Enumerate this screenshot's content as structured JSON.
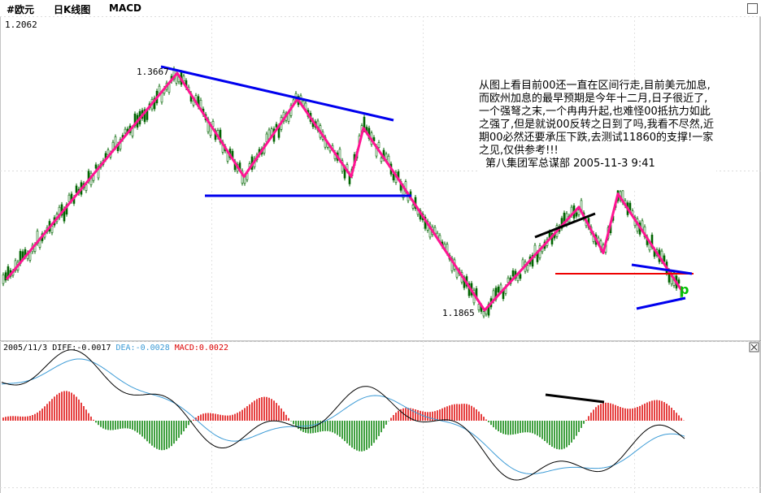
{
  "titlebar": {
    "symbol": "#欧元",
    "period": "日K线图",
    "indicator": "MACD"
  },
  "price_panel": {
    "top_price_label": "1.2062",
    "high_label": "1.3667",
    "low_label": "1.1865",
    "marker": "p"
  },
  "annotation": {
    "text": "从图上看目前00还一直在区间行走,目前美元加息,而欧州加息的最早预期是今年十二月,日子很近了,一个强弩之末,一个冉冉升起,也难怪00抵抗力如此之强了,但是就说00反转之日到了吗,我看不尽然,近期00必然还要承压下跌,去测试11860的支撑!一家之见,仅供参考!!!",
    "signature": "第八集团军总谋部 2005-11-3 9:41"
  },
  "macd_header": {
    "date": "2005/11/3",
    "diff": "DIFF:-0.0017",
    "dea": "DEA:-0.0028",
    "macd": "MACD:0.0022"
  },
  "colors": {
    "trend_pink": "#ff1493",
    "trendline_blue": "#0000ee",
    "trendline_black": "#000000",
    "resistance_red": "#ee0000",
    "candle_green": "#006400",
    "hist_up": "#dd0000",
    "hist_down": "#008000",
    "dea_line": "#3c9bd6",
    "diff_line": "#000000",
    "marker_green": "#00c000"
  },
  "chart_data": {
    "type": "line",
    "title": "#欧元 日K线图",
    "price_path": [
      {
        "label": "",
        "value": 1.21
      },
      {
        "label": "1.3667",
        "value": 1.3667
      },
      {
        "label": "",
        "value": 1.288
      },
      {
        "label": "",
        "value": 1.347
      },
      {
        "label": "",
        "value": 1.288
      },
      {
        "label": "",
        "value": 1.325
      },
      {
        "label": "",
        "value": 1.288
      },
      {
        "label": "1.1865",
        "value": 1.1865
      },
      {
        "label": "",
        "value": 1.265
      },
      {
        "label": "",
        "value": 1.23
      },
      {
        "label": "",
        "value": 1.275
      },
      {
        "label": "",
        "value": 1.2
      }
    ],
    "macd": {
      "diff": -0.0017,
      "dea": -0.0028,
      "macd": 0.0022
    }
  }
}
